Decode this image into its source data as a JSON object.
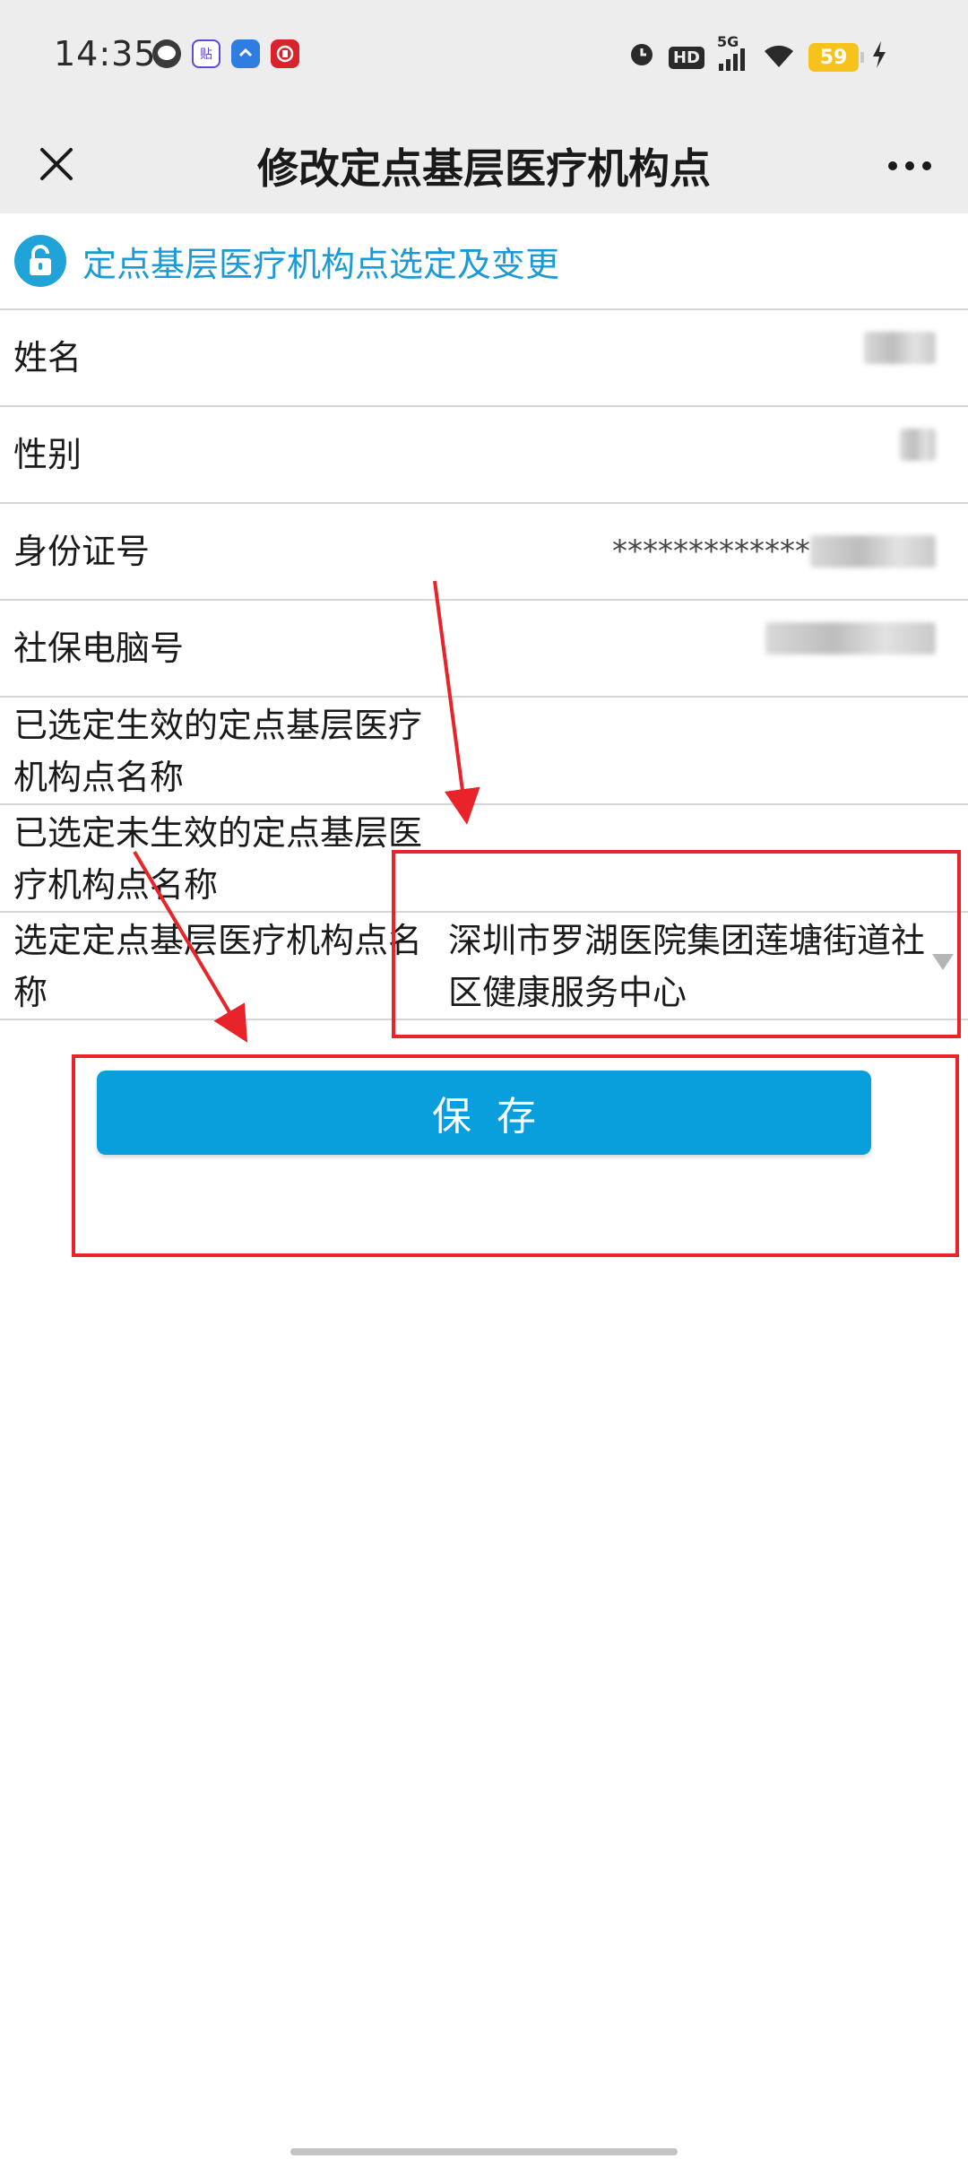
{
  "status_bar": {
    "time": "14:35",
    "left_icons": [
      "chat-bubble-icon",
      "tieba-icon",
      "blue-app-icon",
      "red-app-icon"
    ],
    "network_label": "5G",
    "hd_label": "HD",
    "battery": "59"
  },
  "nav": {
    "title": "修改定点基层医疗机构点"
  },
  "section": {
    "title": "定点基层医疗机构点选定及变更"
  },
  "form": {
    "rows": [
      {
        "label": "姓名",
        "value": ""
      },
      {
        "label": "性别",
        "value": ""
      },
      {
        "label": "身份证号",
        "value": "*************"
      },
      {
        "label": "社保电脑号",
        "value": ""
      },
      {
        "label": "已选定生效的定点基层医疗机构点名称",
        "value": ""
      },
      {
        "label": "已选定未生效的定点基层医疗机构点名称",
        "value": ""
      },
      {
        "label": "选定定点基层医疗机构点名称",
        "value": "深圳市罗湖医院集团莲塘街道社区健康服务中心"
      }
    ]
  },
  "save_button": {
    "label": "保存"
  },
  "colors": {
    "accent": "#089fdc",
    "section_title": "#1b9ad6",
    "annotation": "#e8232a",
    "header_bg": "#ededed"
  }
}
